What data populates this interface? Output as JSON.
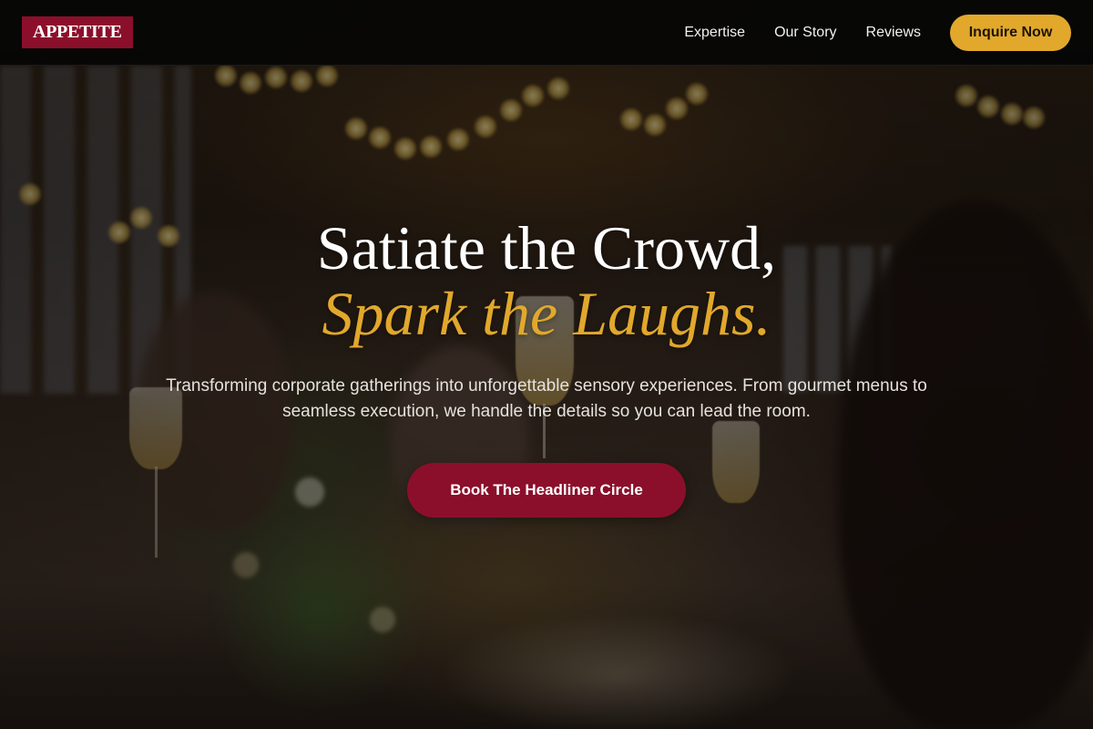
{
  "header": {
    "logo": "APPETITE",
    "nav": [
      {
        "label": "Expertise"
      },
      {
        "label": "Our Story"
      },
      {
        "label": "Reviews"
      }
    ],
    "cta_label": "Inquire Now"
  },
  "hero": {
    "title_line1": "Satiate the Crowd,",
    "title_line2": "Spark the Laughs.",
    "subtitle": "Transforming corporate gatherings into unforgettable sensory experiences. From gourmet menus to seamless execution, we handle the details so you can lead the room.",
    "cta_label": "Book The Headliner Circle"
  },
  "colors": {
    "brand": "#8b0f2b",
    "accent": "#e1a82c",
    "header_bg": "#060606"
  }
}
